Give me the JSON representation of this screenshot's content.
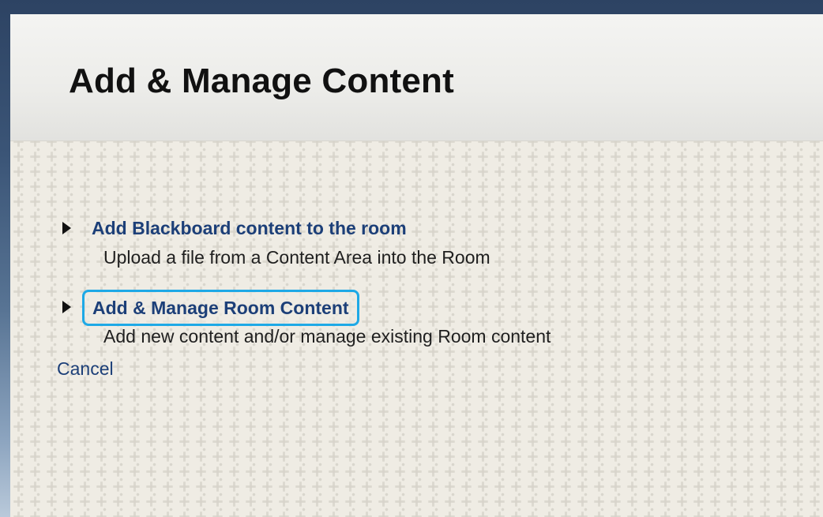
{
  "page": {
    "title": "Add & Manage Content"
  },
  "options": [
    {
      "link_label": "Add Blackboard content to the room",
      "description": "Upload a file from a Content Area into the Room",
      "icon": "triangle-right-icon"
    },
    {
      "link_label": "Add & Manage Room Content",
      "description": "Add new content and/or manage existing Room content",
      "icon": "triangle-right-icon",
      "highlighted": true,
      "highlight_color": "#1ea9e6"
    }
  ],
  "actions": {
    "cancel_label": "Cancel"
  },
  "colors": {
    "link": "#1c3f78",
    "background": "#efece4",
    "frame": "#2d4363"
  }
}
